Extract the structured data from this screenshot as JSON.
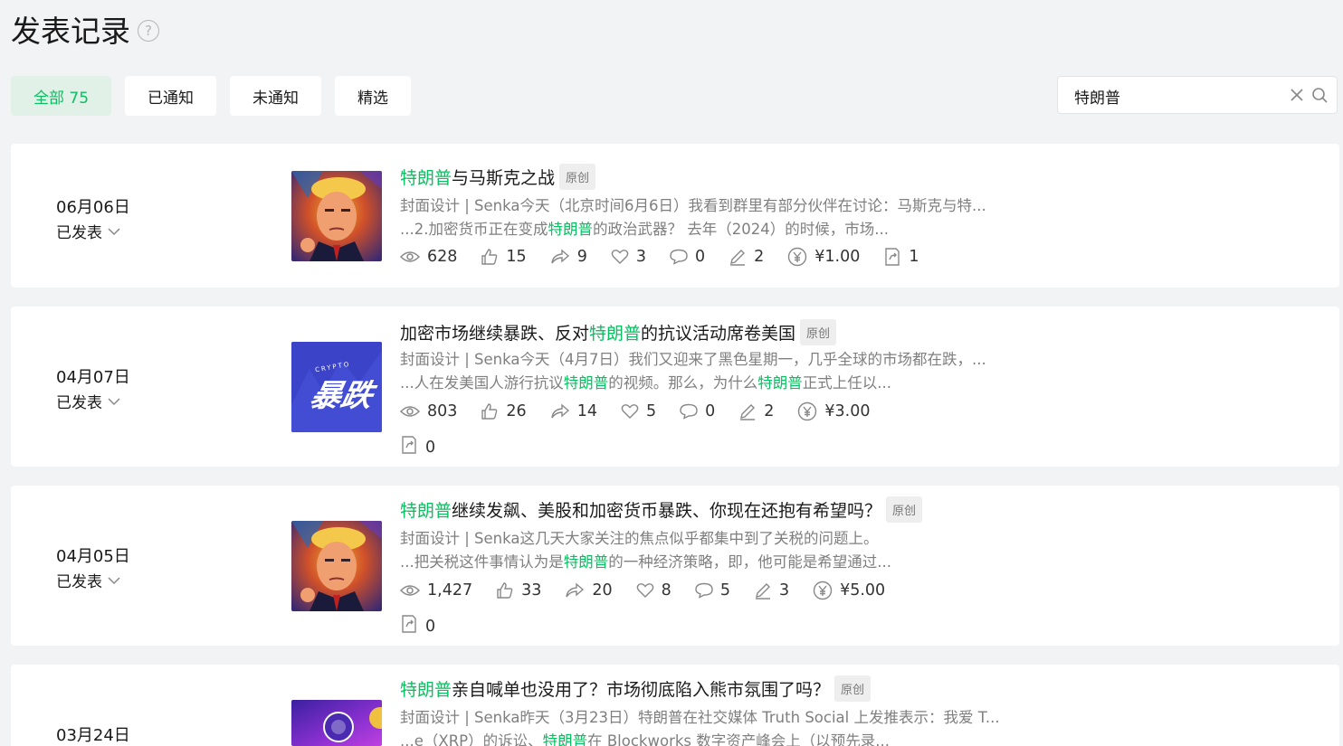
{
  "page": {
    "title": "发表记录",
    "help": "?"
  },
  "filters": [
    {
      "label": "全部 75",
      "active": true
    },
    {
      "label": "已通知"
    },
    {
      "label": "未通知"
    },
    {
      "label": "精选"
    }
  ],
  "search": {
    "value": "特朗普"
  },
  "badge_label": "原创",
  "posts": [
    {
      "date": "06月06日",
      "status": "已发表",
      "title": {
        "hl": "特朗普",
        "rest": "与马斯克之战"
      },
      "summary1": "封面设计 | Senka今天（北京时间6月6日）我看到群里有部分伙伴在讨论：马斯克与特...",
      "summary2": {
        "pre": "...2.加密货币正在变成",
        "hl": "特朗普",
        "post": "的政治武器？ 去年（2024）的时候，市场..."
      },
      "stats": {
        "views": "628",
        "likes": "15",
        "shares": "9",
        "favs": "3",
        "comments": "0",
        "edits": "2",
        "reward": "¥1.00",
        "reposts": "1"
      }
    },
    {
      "date": "04月07日",
      "status": "已发表",
      "title": {
        "pre": "加密市场继续暴跌、反对",
        "hl": "特朗普",
        "post": "的抗议活动席卷美国"
      },
      "summary1": "封面设计 | Senka今天（4月7日）我们又迎来了黑色星期一，几乎全球的市场都在跌，...",
      "summary2": {
        "pre": "...人在发美国人游行抗议",
        "hl": "特朗普",
        "mid": "的视频。那么，为什么",
        "hl2": "特朗普",
        "post": "正式上任以..."
      },
      "thumb_text": "暴跌",
      "thumb_small": "CRYPTO",
      "stats": {
        "views": "803",
        "likes": "26",
        "shares": "14",
        "favs": "5",
        "comments": "0",
        "edits": "2",
        "reward": "¥3.00",
        "reposts": "0"
      }
    },
    {
      "date": "04月05日",
      "status": "已发表",
      "title": {
        "hl": "特朗普",
        "rest": "继续发飙、美股和加密货币暴跌、你现在还抱有希望吗？"
      },
      "summary1": "封面设计 | Senka这几天大家关注的焦点似乎都集中到了关税的问题上。",
      "summary2": {
        "pre": "...把关税这件事情认为是",
        "hl": "特朗普",
        "post": "的一种经济策略，即，他可能是希望通过..."
      },
      "stats": {
        "views": "1,427",
        "likes": "33",
        "shares": "20",
        "favs": "8",
        "comments": "5",
        "edits": "3",
        "reward": "¥5.00",
        "reposts": "0"
      }
    },
    {
      "date": "03月24日",
      "title": {
        "hl": "特朗普",
        "rest": "亲自喊单也没用了？市场彻底陷入熊市氛围了吗？"
      },
      "summary1": "封面设计 | Senka昨天（3月23日）特朗普在社交媒体 Truth Social 上发推表示：我爱 T...",
      "summary2": {
        "pre": "...e（XRP）的诉讼、",
        "hl": "特朗普",
        "post": "在 Blockworks 数字资产峰会上（以预先录..."
      }
    }
  ],
  "colors": {
    "accent": "#07c160",
    "badge_bg": "#eeeeee",
    "thumb2_bg": "#3b44c8"
  }
}
